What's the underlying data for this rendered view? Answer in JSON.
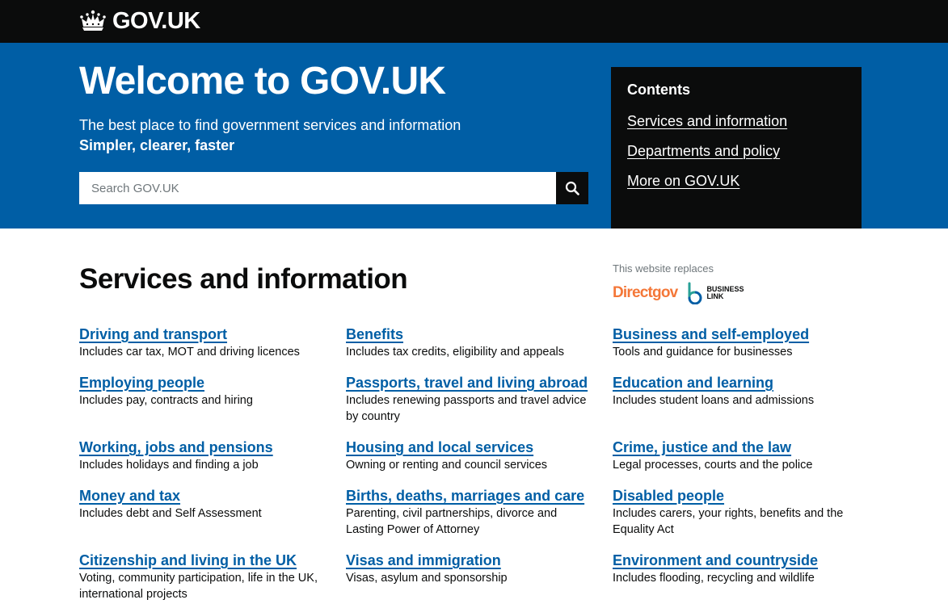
{
  "header": {
    "logo_text": "GOV.UK",
    "logo_icon": "crown-icon"
  },
  "hero": {
    "title": "Welcome to GOV.UK",
    "intro": "The best place to find government services and information",
    "tagline": "Simpler, clearer, faster",
    "search": {
      "placeholder": "Search GOV.UK",
      "value": "",
      "button_icon": "search-icon"
    }
  },
  "contents": {
    "title": "Contents",
    "links": [
      "Services and information",
      "Departments and policy",
      "More on GOV.UK"
    ]
  },
  "services": {
    "heading": "Services and information",
    "replaces": {
      "label": "This website replaces",
      "logo_directgov": "Directgov",
      "logo_businesslink_line1": "BUSINESS",
      "logo_businesslink_line2": "LINK"
    },
    "items": [
      {
        "title": "Driving and transport",
        "desc": "Includes car tax, MOT and driving licences"
      },
      {
        "title": "Benefits",
        "desc": "Includes tax credits, eligibility and appeals"
      },
      {
        "title": "Business and self-employed",
        "desc": "Tools and guidance for businesses"
      },
      {
        "title": "Employing people",
        "desc": "Includes pay, contracts and hiring"
      },
      {
        "title": "Passports, travel and living abroad",
        "desc": "Includes renewing passports and travel advice by country"
      },
      {
        "title": "Education and learning",
        "desc": "Includes student loans and admissions"
      },
      {
        "title": "Working, jobs and pensions",
        "desc": "Includes holidays and finding a job"
      },
      {
        "title": "Housing and local services",
        "desc": "Owning or renting and council services"
      },
      {
        "title": "Crime, justice and the law",
        "desc": "Legal processes, courts and the police"
      },
      {
        "title": "Money and tax",
        "desc": "Includes debt and Self Assessment"
      },
      {
        "title": "Births, deaths, marriages and care",
        "desc": "Parenting, civil partnerships, divorce and Lasting Power of Attorney"
      },
      {
        "title": "Disabled people",
        "desc": "Includes carers, your rights, benefits and the Equality Act"
      },
      {
        "title": "Citizenship and living in the UK",
        "desc": "Voting, community participation, life in the UK, international projects"
      },
      {
        "title": "Visas and immigration",
        "desc": "Visas, asylum and sponsorship"
      },
      {
        "title": "Environment and countryside",
        "desc": "Includes flooding, recycling and wildlife"
      }
    ]
  },
  "colors": {
    "header_bg": "#0b0c0c",
    "hero_bg": "#005ea5",
    "link": "#005ea5",
    "directgov_orange": "#f47738",
    "businesslink_teal": "#28a197",
    "businesslink_blue": "#005ea5"
  }
}
